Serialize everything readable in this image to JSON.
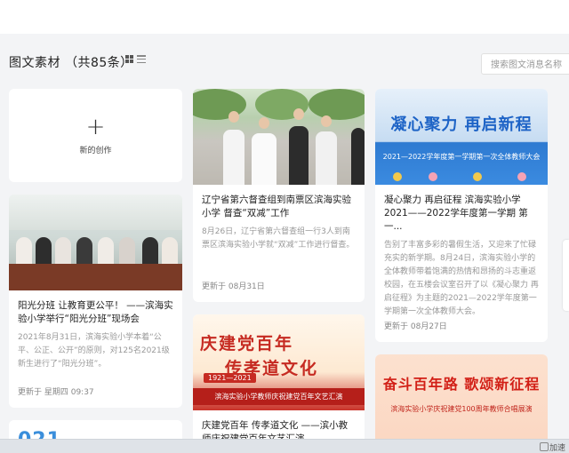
{
  "header": {
    "title": "图文素材 （共85条）",
    "search_placeholder": "搜索图文消息名称"
  },
  "new_card": {
    "plus": "+",
    "label": "新的创作"
  },
  "cards": [
    {
      "title": "阳光分班 让教育更公平！ ——滨海实验小学举行“阳光分班”现场会",
      "desc": "2021年8月31日，滨海实验小学本着“公平、公正、公开”的原则，对125名2021级新生进行了“阳光分班”。",
      "date": "更新于 星期四 09:37"
    },
    {
      "title": "辽宁省第六督查组到南票区滨海实验小学 督查“双减”工作",
      "desc": "8月26日，辽宁省第六督查组一行3人到南票区滨海实验小学就“双减”工作进行督查。",
      "date": "更新于 08月31日"
    },
    {
      "title": "凝心聚力 再启征程 滨海实验小学2021——2022学年度第一学期 第一...",
      "desc": "告别了丰富多彩的暑假生活，又迎来了忙碌充实的新学期。8月24日，滨海实验小学的全体教师带着饱满的热情和昂扬的斗志重返校园，在五楼会议室召开了以《凝心聚力 再启征程》为主题的2021—2022学年度第一学期第一次全体教师大会。",
      "date": "更新于 08月27日",
      "banner_big": "凝心聚力  再启新程",
      "banner_small": "2021—2022学年度第一学期第一次全体教师大会"
    },
    {
      "title": "庆建党百年 传孝道文化 ——滨小教师庆祝建党百年文艺汇演",
      "banner_line1": "庆建党百年",
      "banner_line2": "传孝道文化",
      "banner_years": "1921—2021",
      "banner_sub": "滨海实验小学教师庆祝建党百年文艺汇演"
    },
    {
      "banner_big": "奋斗百年路  歌颂新征程",
      "banner_sub": "滨海实验小学庆祝建党100周年教师合唱展演"
    },
    {
      "banner_big": "021"
    }
  ],
  "taskbar": {
    "text": "加速"
  },
  "colors": {
    "accent_blue": "#1d63c6",
    "accent_red": "#c62b22",
    "background": "#f3f4f6"
  },
  "icons": [
    "grid-view-icon",
    "list-view-icon",
    "plus-icon",
    "window-icon"
  ]
}
